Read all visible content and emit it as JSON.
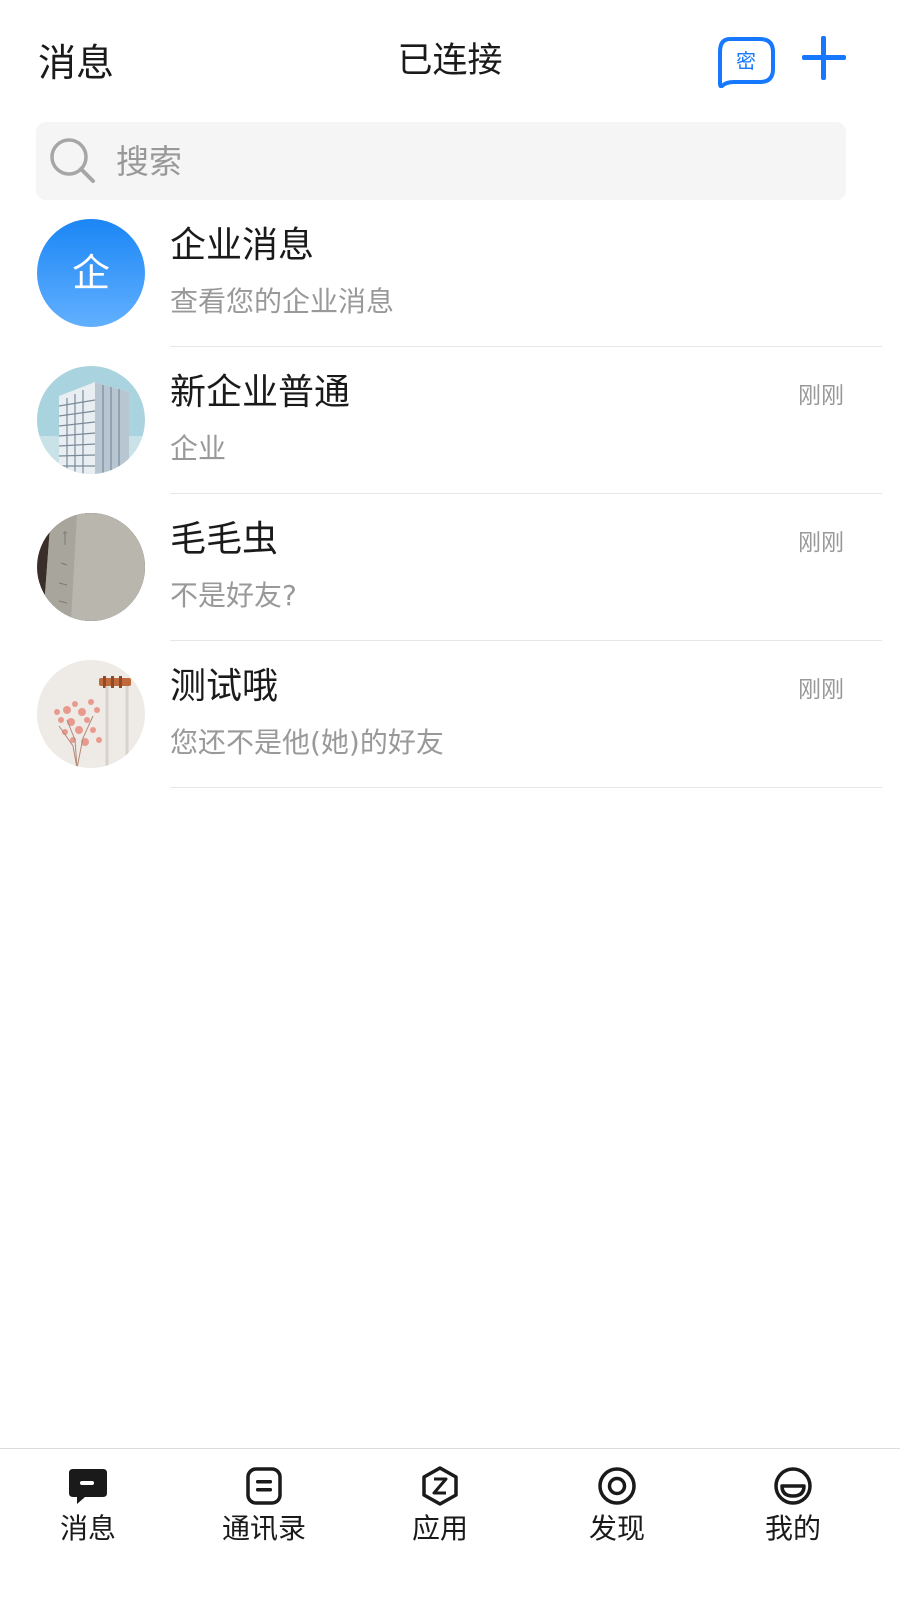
{
  "header": {
    "title": "消息",
    "status": "已连接",
    "secret_label": "密",
    "accent_color": "#1677ff"
  },
  "search": {
    "placeholder": "搜索"
  },
  "conversations": [
    {
      "name": "企业消息",
      "preview": "查看您的企业消息",
      "time": "",
      "avatar_text": "企",
      "avatar_type": "enterprise-logo"
    },
    {
      "name": "新企业普通",
      "preview": "企业",
      "time": "刚刚",
      "avatar_type": "building-photo"
    },
    {
      "name": "毛毛虫",
      "preview": "不是好友?",
      "time": "刚刚",
      "avatar_type": "paper-photo"
    },
    {
      "name": "测试哦",
      "preview": "您还不是他(她)的好友",
      "time": "刚刚",
      "avatar_type": "flowers-photo"
    }
  ],
  "bottom_nav": [
    {
      "label": "消息",
      "icon": "message-icon",
      "active": true
    },
    {
      "label": "通讯录",
      "icon": "contacts-icon",
      "active": false
    },
    {
      "label": "应用",
      "icon": "apps-icon",
      "active": false
    },
    {
      "label": "发现",
      "icon": "discover-icon",
      "active": false
    },
    {
      "label": "我的",
      "icon": "profile-icon",
      "active": false
    }
  ]
}
